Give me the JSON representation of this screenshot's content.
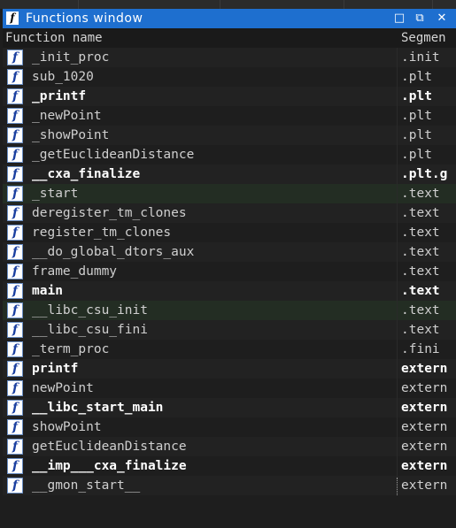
{
  "window": {
    "title": "Functions window",
    "controls": [
      "□",
      "⧉",
      "✕"
    ]
  },
  "columns": {
    "name": "Function name",
    "segment": "Segmen"
  },
  "rows": [
    {
      "name": "_init_proc",
      "segment": ".init",
      "bold": false,
      "highlight": false
    },
    {
      "name": "sub_1020",
      "segment": ".plt",
      "bold": false,
      "highlight": false
    },
    {
      "name": "_printf",
      "segment": ".plt",
      "bold": true,
      "highlight": false
    },
    {
      "name": "_newPoint",
      "segment": ".plt",
      "bold": false,
      "highlight": false
    },
    {
      "name": "_showPoint",
      "segment": ".plt",
      "bold": false,
      "highlight": false
    },
    {
      "name": "_getEuclideanDistance",
      "segment": ".plt",
      "bold": false,
      "highlight": false
    },
    {
      "name": "__cxa_finalize",
      "segment": ".plt.g",
      "bold": true,
      "highlight": false
    },
    {
      "name": "_start",
      "segment": ".text",
      "bold": false,
      "highlight": true
    },
    {
      "name": "deregister_tm_clones",
      "segment": ".text",
      "bold": false,
      "highlight": false
    },
    {
      "name": "register_tm_clones",
      "segment": ".text",
      "bold": false,
      "highlight": false
    },
    {
      "name": "__do_global_dtors_aux",
      "segment": ".text",
      "bold": false,
      "highlight": false
    },
    {
      "name": "frame_dummy",
      "segment": ".text",
      "bold": false,
      "highlight": false
    },
    {
      "name": "main",
      "segment": ".text",
      "bold": true,
      "highlight": false
    },
    {
      "name": "__libc_csu_init",
      "segment": ".text",
      "bold": false,
      "highlight": true
    },
    {
      "name": "__libc_csu_fini",
      "segment": ".text",
      "bold": false,
      "highlight": false
    },
    {
      "name": "_term_proc",
      "segment": ".fini",
      "bold": false,
      "highlight": false
    },
    {
      "name": "printf",
      "segment": "extern",
      "bold": true,
      "highlight": false
    },
    {
      "name": "newPoint",
      "segment": "extern",
      "bold": false,
      "highlight": false
    },
    {
      "name": "__libc_start_main",
      "segment": "extern",
      "bold": true,
      "highlight": false
    },
    {
      "name": "showPoint",
      "segment": "extern",
      "bold": false,
      "highlight": false
    },
    {
      "name": "getEuclideanDistance",
      "segment": "extern",
      "bold": false,
      "highlight": false
    },
    {
      "name": "__imp___cxa_finalize",
      "segment": "extern",
      "bold": true,
      "highlight": false
    },
    {
      "name": "__gmon_start__",
      "segment": "extern",
      "bold": false,
      "highlight": false
    }
  ],
  "icons": {
    "function": "function-icon"
  },
  "colors": {
    "titlebar": "#1e6fcf",
    "background": "#1e1e1e",
    "highlight": "#232d23"
  }
}
